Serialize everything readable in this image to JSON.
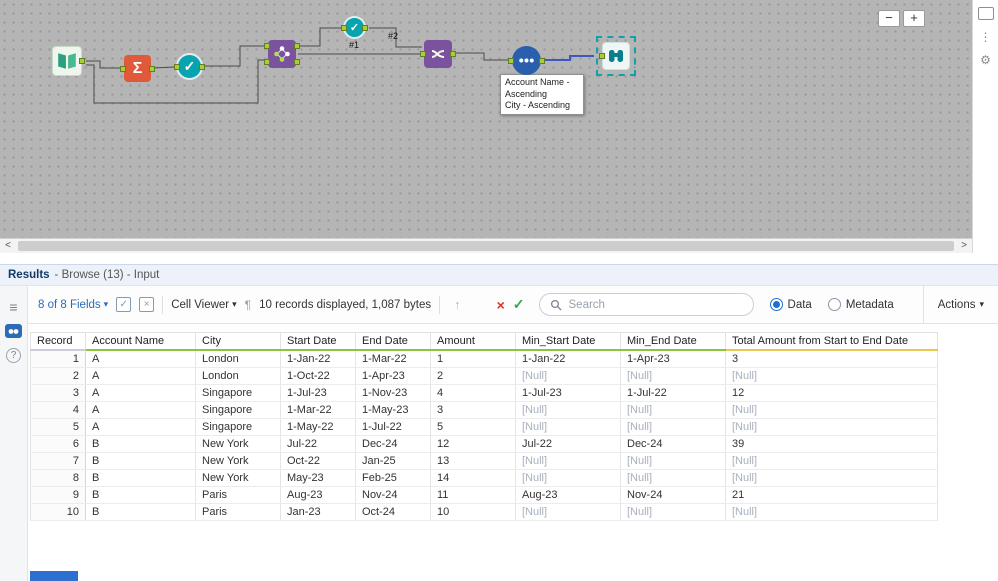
{
  "icons": {
    "minus": "−",
    "plus": "+",
    "scroll_left": "<",
    "scroll_right": ">",
    "sigma": "Σ",
    "check": "✓",
    "list": "≡",
    "help": "?",
    "caret": "▾",
    "pilcrow": "¶",
    "up_arrow": "↑",
    "close_x": "×",
    "gear": "⚙",
    "dots": "⋮"
  },
  "canvas": {
    "tooltip": {
      "line1": "Account Name -",
      "line2": "Ascending",
      "line3": "City - Ascending"
    },
    "wire_labels": {
      "first": "#1",
      "second": "#2"
    }
  },
  "results": {
    "title": "Results",
    "subtitle": "- Browse (13) - Input",
    "toolbar": {
      "fields_dropdown": "8 of 8 Fields",
      "cell_viewer": "Cell Viewer",
      "records_info": "10 records displayed, 1,087 bytes",
      "search_placeholder": "Search",
      "data_label": "Data",
      "metadata_label": "Metadata",
      "actions_label": "Actions"
    },
    "table": {
      "columns": [
        {
          "label": "Record",
          "accent": ""
        },
        {
          "label": "Account Name",
          "accent": "#8bc53f"
        },
        {
          "label": "City",
          "accent": "#8bc53f"
        },
        {
          "label": "Start Date",
          "accent": "#8bc53f"
        },
        {
          "label": "End Date",
          "accent": "#8bc53f"
        },
        {
          "label": "Amount",
          "accent": "#8bc53f"
        },
        {
          "label": "Min_Start Date",
          "accent": "#8bc53f"
        },
        {
          "label": "Min_End Date",
          "accent": "#8bc53f"
        },
        {
          "label": "Total Amount from Start to End Date",
          "accent": "#e9c94d"
        }
      ],
      "null_text": "[Null]",
      "rows": [
        [
          "1",
          "A",
          "London",
          "1-Jan-22",
          "1-Mar-22",
          "1",
          "1-Jan-22",
          "1-Apr-23",
          "3"
        ],
        [
          "2",
          "A",
          "London",
          "1-Oct-22",
          "1-Apr-23",
          "2",
          "[Null]",
          "[Null]",
          "[Null]"
        ],
        [
          "3",
          "A",
          "Singapore",
          "1-Jul-23",
          "1-Nov-23",
          "4",
          "1-Jul-23",
          "1-Jul-22",
          "12"
        ],
        [
          "4",
          "A",
          "Singapore",
          "1-Mar-22",
          "1-May-23",
          "3",
          "[Null]",
          "[Null]",
          "[Null]"
        ],
        [
          "5",
          "A",
          "Singapore",
          "1-May-22",
          "1-Jul-22",
          "5",
          "[Null]",
          "[Null]",
          "[Null]"
        ],
        [
          "6",
          "B",
          "New York",
          "Jul-22",
          "Dec-24",
          "12",
          "Jul-22",
          "Dec-24",
          "39"
        ],
        [
          "7",
          "B",
          "New York",
          "Oct-22",
          "Jan-25",
          "13",
          "[Null]",
          "[Null]",
          "[Null]"
        ],
        [
          "8",
          "B",
          "New York",
          "May-23",
          "Feb-25",
          "14",
          "[Null]",
          "[Null]",
          "[Null]"
        ],
        [
          "9",
          "B",
          "Paris",
          "Aug-23",
          "Nov-24",
          "11",
          "Aug-23",
          "Nov-24",
          "21"
        ],
        [
          "10",
          "B",
          "Paris",
          "Jan-23",
          "Oct-24",
          "10",
          "[Null]",
          "[Null]",
          "[Null]"
        ]
      ]
    }
  }
}
